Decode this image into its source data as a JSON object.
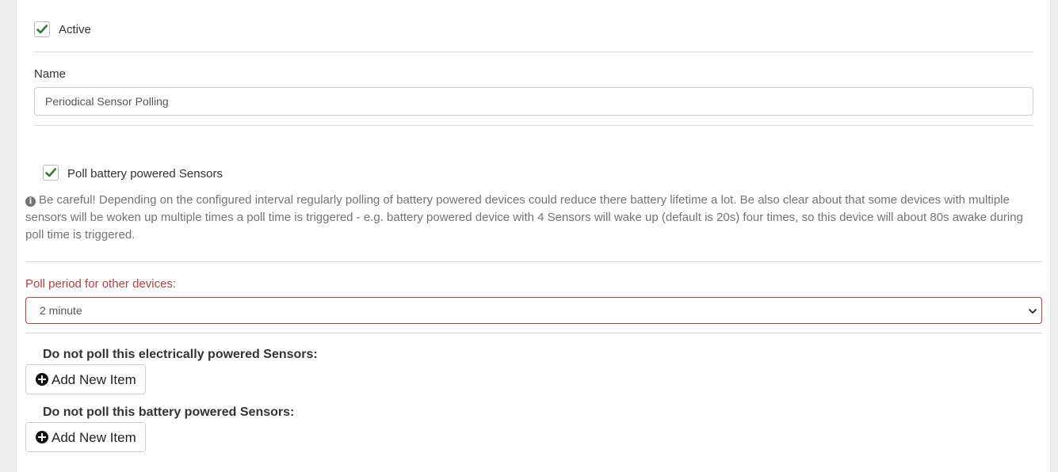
{
  "active": {
    "label": "Active",
    "checked": true
  },
  "name": {
    "label": "Name",
    "value": "Periodical Sensor Polling"
  },
  "poll_battery": {
    "label": "Poll battery powered Sensors",
    "checked": true,
    "info_text": "Be careful! Depending on the configured interval regularly polling of battery powered devices could reduce there battery lifetime a lot. Be also clear about that some devices with multiple sensors will be woken up multiple times a poll time is triggered - e.g. battery powered device with 4 Sensors will wake up (default is 20s) four times, so this device will about 80s awake during poll time is triggered."
  },
  "poll_period": {
    "label": "Poll period for other devices:",
    "selected": "2 minute"
  },
  "exclude_electric": {
    "label": "Do not poll this electrically powered Sensors:",
    "button_label": "Add New Item"
  },
  "exclude_battery": {
    "label": "Do not poll this battery powered Sensors:",
    "button_label": "Add New Item"
  },
  "colors": {
    "check": "#3c763d",
    "error": "#a94442"
  }
}
